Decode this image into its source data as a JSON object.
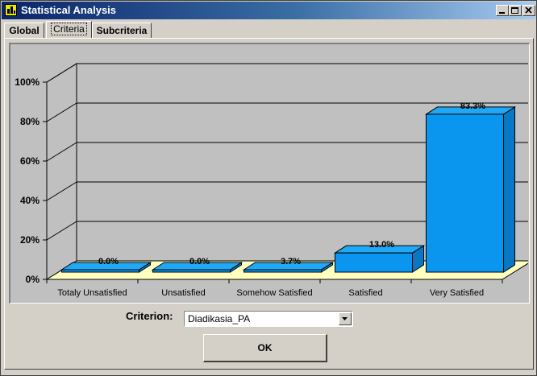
{
  "window": {
    "title": "Statistical Analysis"
  },
  "tabs": [
    {
      "label": "Global"
    },
    {
      "label": "Criteria"
    },
    {
      "label": "Subcriteria"
    }
  ],
  "active_tab": 1,
  "chart_data": {
    "type": "bar",
    "categories": [
      "Totaly Unsatisfied",
      "Unsatisfied",
      "Somehow Satisfied",
      "Satisfied",
      "Very Satisfied"
    ],
    "values": [
      0.0,
      0.0,
      3.7,
      13.0,
      83.3
    ],
    "value_labels": [
      "0.0%",
      "0.0%",
      "3.7%",
      "13.0%",
      "83.3%"
    ],
    "y_ticks": [
      "0%",
      "20%",
      "40%",
      "60%",
      "80%",
      "100%"
    ],
    "ylim": [
      0,
      100
    ],
    "grid": true,
    "three_d": true,
    "bar_color": "#0a96ee",
    "floor_color": "#ffffc0",
    "wall_color": "#c0c0c0"
  },
  "criterion": {
    "label": "Criterion:",
    "value": "Diadikasia_PA"
  },
  "ok_button": {
    "label": "OK"
  }
}
